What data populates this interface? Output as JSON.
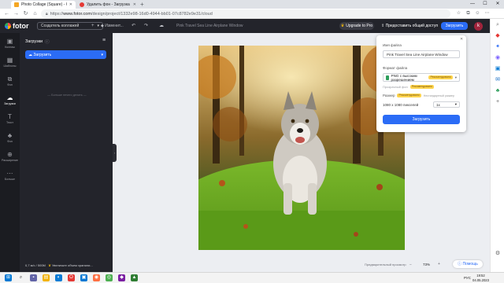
{
  "browser": {
    "tabs": [
      {
        "title": "Photo Collage (Square) - Collage",
        "active": true,
        "favicon_color": "#f4a623"
      },
      {
        "title": "Удалить фон - Загрузка изобр...",
        "active": false,
        "favicon_color": "#e53935"
      }
    ],
    "url_prefix": "https://",
    "url_domain": "www.fotor.com",
    "url_path": "/design/project/1332e98-16d0-4944-bb01-07c8782e9e31/cloud",
    "window_controls": [
      "—",
      "☐",
      "✕"
    ]
  },
  "app": {
    "logo_text": "fotor",
    "create_button_label": "Создатель коллажей",
    "improve_label": "Изменит...",
    "document_title": "Pink Travel Sea Line Airplane Window",
    "pro_label": "Upgrade to Pro",
    "share_label": "Предоставить общий доступ",
    "download_label": "Загрузить",
    "avatar_letter": "k"
  },
  "rail": [
    {
      "icon": "▣",
      "label": "Коллаж",
      "active": false
    },
    {
      "icon": "▦",
      "label": "Шаблоны",
      "active": false
    },
    {
      "icon": "⧉",
      "label": "Фон",
      "active": false
    },
    {
      "icon": "☁",
      "label": "Загрузки",
      "active": true
    },
    {
      "icon": "T",
      "label": "Текст",
      "active": false
    },
    {
      "icon": "♣",
      "label": "Фон",
      "active": false
    },
    {
      "icon": "⊕",
      "label": "Расширение",
      "active": false
    },
    {
      "icon": "⋯",
      "label": "Больше",
      "active": false
    }
  ],
  "panel": {
    "title": "Загрузки",
    "upload_button": "Загрузить",
    "empty_text": "Больше нечего делать",
    "storage_text": "0,7 м/с / 500M",
    "storage_upgrade": "Увеличьте объем хранили..."
  },
  "canvas": {
    "zoom_label": "Предварительный просмотр",
    "zoom_value": "73%",
    "help_label": "Помощь"
  },
  "download_dialog": {
    "filename_label": "Имя файла",
    "filename_value": "Pink Travel Sea Line Airplane Window",
    "format_label": "Формат файла",
    "format_value": "PNG с высоким разрешением",
    "format_badge": "Рекомендовано",
    "transparent_label": "Прозрачный фон",
    "transparent_badge": "Рекомендовано",
    "size_label": "Размер",
    "size_badge": "Рекомендовано",
    "size_alt": "Нестандартный размер",
    "size_value": "1080 x 1080 пикселей",
    "multiplier": "1x",
    "download_button": "Загрузить"
  },
  "taskbar": {
    "lang": "РУС",
    "time": "19:52",
    "date": "04.05.2023"
  },
  "colors": {
    "accent": "#2b6cf6",
    "toolbar_bg": "#23242b",
    "rail_bg": "#1b1c21",
    "canvas_bg": "#eceef2"
  }
}
